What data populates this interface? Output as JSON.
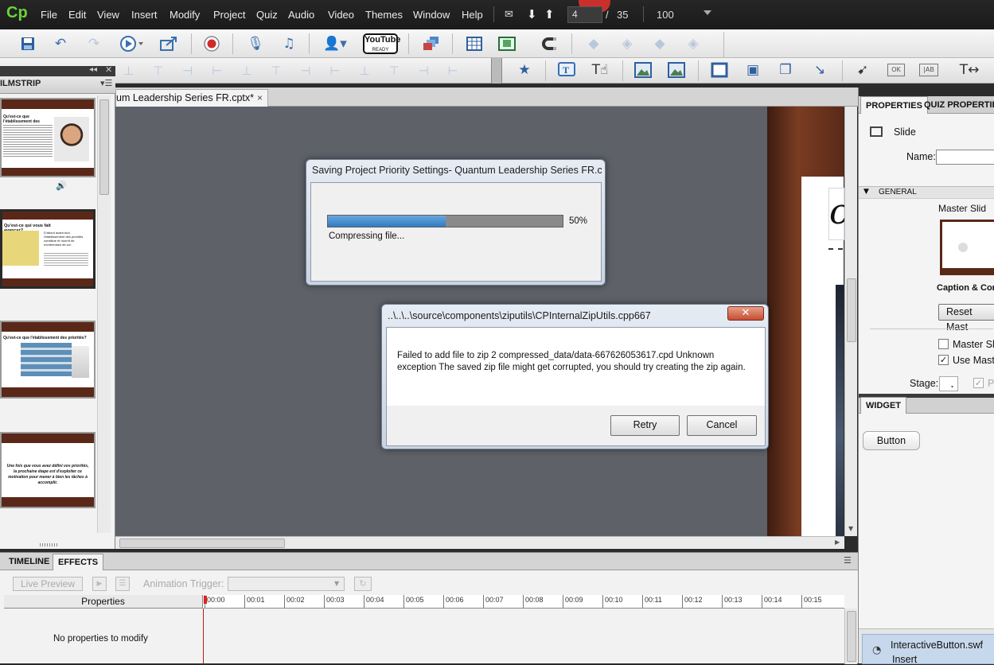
{
  "menubar": {
    "logo": "Cp",
    "items": [
      "File",
      "Edit",
      "View",
      "Insert",
      "Modify",
      "Project",
      "Quiz",
      "Audio",
      "Video",
      "Themes",
      "Window",
      "Help"
    ],
    "slide_current": "4",
    "slide_separator": "/",
    "slide_total": "35",
    "zoom": "100"
  },
  "toolbar": {
    "youtube_label": "YouTube",
    "youtube_sub": "READY"
  },
  "filmstrip": {
    "tab_label": "FILMSTRIP",
    "tab_visible": "ILMSTRIP",
    "thumbs": [
      {
        "heading": "Qu'est-ce que l'établissement des priorités?",
        "has_audio": true
      },
      {
        "heading": "Qu'est-ce qui vous fait avancer?",
        "subtitle": "D'abord avant tout, l'établissement des priorités constitue et nourrit de nombreuses de soi."
      },
      {
        "heading": "Qu'est-ce que l'établissement des priorités?"
      },
      {
        "heading": "",
        "body": "Une fois que vous avez défini vos priorités, la prochaine étape est d'exploiter ce motivation pour mener à bien les tâches à accomplir."
      }
    ]
  },
  "document": {
    "tab_title": "um Leadership Series FR.cptx*",
    "tab_close": "×"
  },
  "progress_dialog": {
    "title": "Saving Project Priority Settings- Quantum Leadership Series FR.cpt...",
    "progress": 0.5,
    "percent_label": "50%",
    "status": "Compressing file..."
  },
  "error_dialog": {
    "title": "..\\..\\..\\source\\components\\ziputils\\CPInternalZipUtils.cpp667",
    "close": "✕",
    "message": "Failed to add file to zip 2 compressed_data/data-667626053617.cpd Unknown exception The saved zip file might get corrupted, you should try creating the zip again.",
    "retry": "Retry",
    "cancel": "Cancel"
  },
  "properties": {
    "tabs": [
      "PROPERTIES",
      "QUIZ PROPERTIES"
    ],
    "object_type": "Slide",
    "name_label": "Name:",
    "name_value": "",
    "section_general": "GENERAL",
    "master_slide_label": "Master Slid",
    "master_thumb_caption": "Caption & Con",
    "reset_master_button": "Reset Mast",
    "master_slide_objects": "Master Slid",
    "master_slide_objects_checked": false,
    "use_master_bg": "Use Maste",
    "use_master_bg_checked": true,
    "stage_label": "Stage:",
    "stage_extra": "Pr"
  },
  "widget": {
    "tab": "WIDGET",
    "button_label": "Button",
    "file_name": "InteractiveButton.swf",
    "file_action": "Insert"
  },
  "timeline": {
    "tabs": [
      "TIMELINE",
      "EFFECTS"
    ],
    "live_preview": "Live Preview",
    "animation_trigger": "Animation Trigger:",
    "properties_header": "Properties",
    "no_properties": "No properties to modify",
    "ruler": [
      "00:00",
      "00:01",
      "00:02",
      "00:03",
      "00:04",
      "00:05",
      "00:06",
      "00:07",
      "00:08",
      "00:09",
      "00:10",
      "00:11",
      "00:12",
      "00:13",
      "00:14",
      "00:15"
    ]
  }
}
